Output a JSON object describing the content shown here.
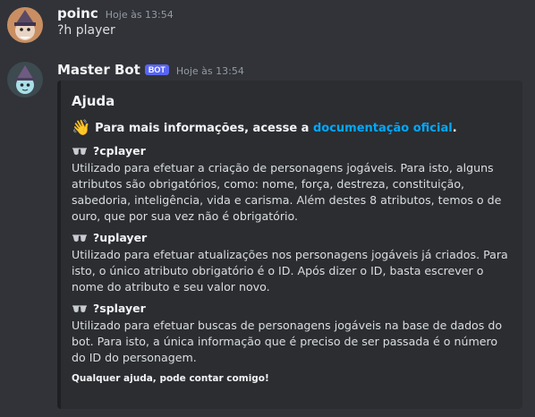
{
  "messages": [
    {
      "username": "poinc",
      "timestamp": "Hoje às 13:54",
      "content": "?h player"
    },
    {
      "username": "Master Bot",
      "badge": "BOT",
      "timestamp": "Hoje às 13:54"
    }
  ],
  "embed": {
    "title": "Ajuda",
    "intro_prefix": "Para mais informações, acesse a ",
    "intro_link": "documentação oficial",
    "intro_suffix": ".",
    "commands": [
      {
        "name": "?cplayer",
        "description": "Utilizado para efetuar a criação de personagens jogáveis. Para isto, alguns atributos são obrigatórios, como: nome, força, destreza, constituição, sabedoria, inteligência, vida e carisma. Além destes 8 atributos, temos o de ouro, que por sua vez não é obrigatório."
      },
      {
        "name": "?uplayer",
        "description": "Utilizado para efetuar atualizações nos personagens jogáveis já criados. Para isto, o único atributo obrigatório é o ID. Após dizer o ID, basta escrever o nome do atributo e seu valor novo."
      },
      {
        "name": "?splayer",
        "description": "Utilizado para efetuar buscas de personagens jogáveis na base de dados do bot. Para isto, a única informação que é preciso de ser passada é o número do ID do personagem."
      }
    ],
    "footer": "Qualquer ajuda, pode contar comigo!"
  },
  "icons": {
    "wave": "waving-hand-icon",
    "command": "sunglasses-icon"
  },
  "colors": {
    "background": "#313338",
    "embed_bg": "#2b2d31",
    "link": "#00a8fc",
    "badge": "#5865f2"
  }
}
